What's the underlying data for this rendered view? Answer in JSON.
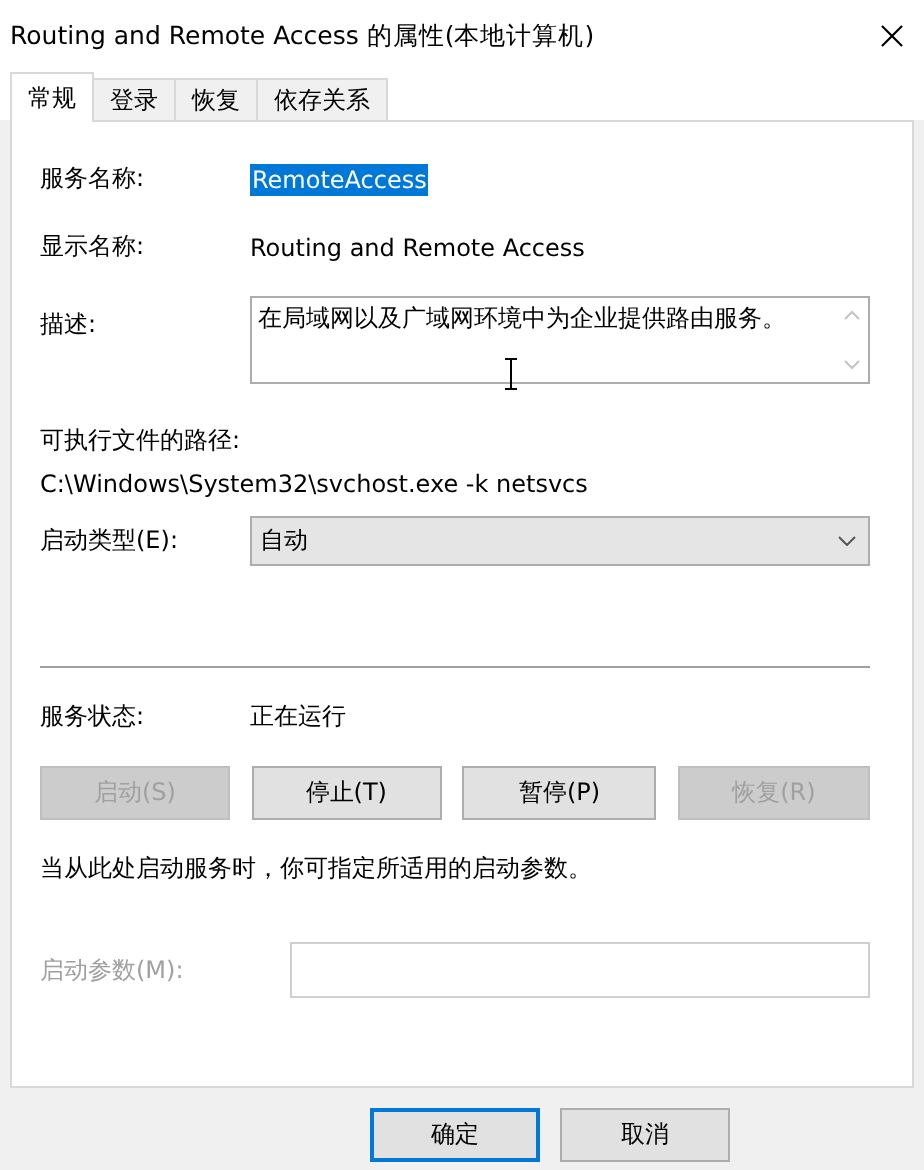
{
  "window": {
    "title": "Routing and Remote Access 的属性(本地计算机)"
  },
  "tabs": [
    {
      "label": "常规",
      "selected": true
    },
    {
      "label": "登录",
      "selected": false
    },
    {
      "label": "恢复",
      "selected": false
    },
    {
      "label": "依存关系",
      "selected": false
    }
  ],
  "service_name": {
    "label": "服务名称:",
    "value": "RemoteAccess",
    "highlighted": true
  },
  "display_name": {
    "label": "显示名称:",
    "value": "Routing and Remote Access"
  },
  "description": {
    "label": "描述:",
    "value": "在局域网以及广域网环境中为企业提供路由服务。"
  },
  "executable_path": {
    "label": "可执行文件的路径:",
    "value": "C:\\Windows\\System32\\svchost.exe -k netsvcs"
  },
  "startup_type": {
    "label": "启动类型(E):",
    "value": "自动"
  },
  "service_status": {
    "label": "服务状态:",
    "value": "正在运行"
  },
  "control_buttons": [
    {
      "label": "启动(S)",
      "disabled": true
    },
    {
      "label": "停止(T)",
      "disabled": false
    },
    {
      "label": "暂停(P)",
      "disabled": false
    },
    {
      "label": "恢复(R)",
      "disabled": true
    }
  ],
  "hint": "当从此处启动服务时，你可指定所适用的启动参数。",
  "start_parameters": {
    "label": "启动参数(M):",
    "disabled": true
  },
  "footer_buttons": [
    {
      "label": "确定",
      "default": true
    },
    {
      "label": "取消",
      "default": false
    }
  ]
}
